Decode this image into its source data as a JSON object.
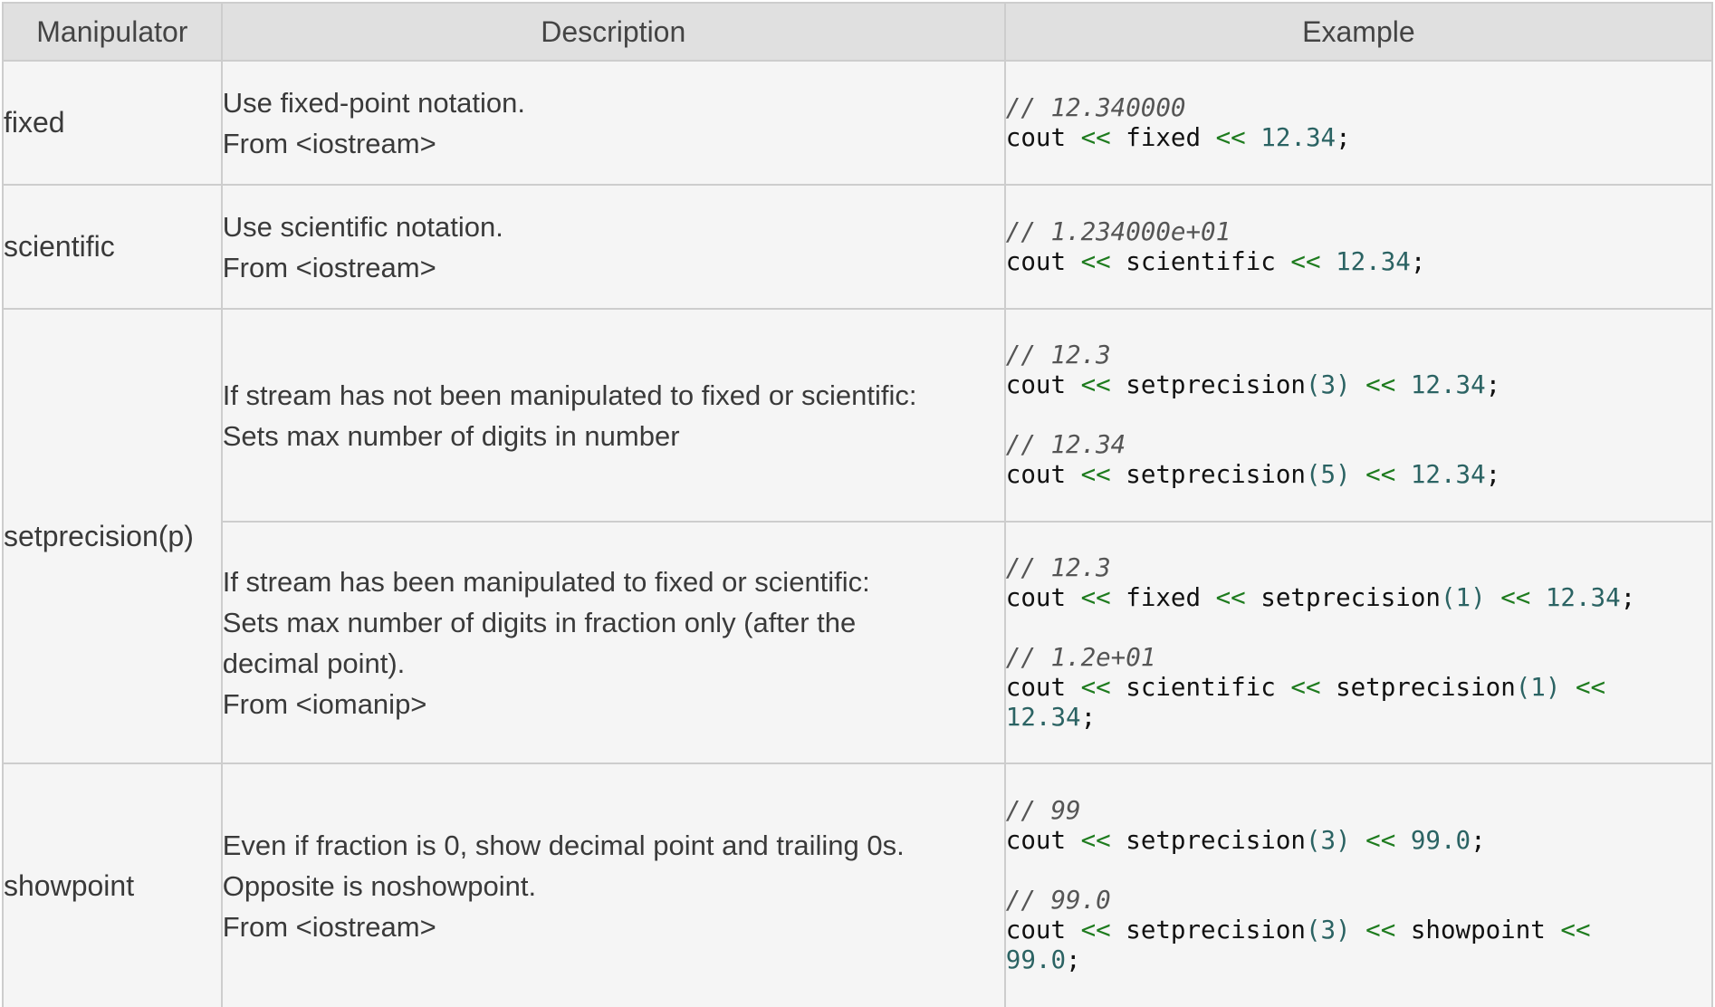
{
  "headers": {
    "manipulator": "Manipulator",
    "description": "Description",
    "example": "Example"
  },
  "rows": {
    "fixed": {
      "name": "fixed",
      "desc": [
        "Use fixed-point notation.",
        "From <iostream>"
      ],
      "examples": [
        {
          "comment": "// 12.340000",
          "code": [
            [
              [
                "t",
                "cout "
              ],
              [
                "o",
                "<<"
              ],
              [
                "t",
                " fixed "
              ],
              [
                "o",
                "<<"
              ],
              [
                "n",
                " 12.34"
              ],
              [
                "t",
                ";"
              ]
            ]
          ]
        }
      ]
    },
    "scientific": {
      "name": "scientific",
      "desc": [
        "Use scientific notation.",
        "From <iostream>"
      ],
      "examples": [
        {
          "comment": "// 1.234000e+01",
          "code": [
            [
              [
                "t",
                "cout "
              ],
              [
                "o",
                "<<"
              ],
              [
                "t",
                " scientific "
              ],
              [
                "o",
                "<<"
              ],
              [
                "n",
                " 12.34"
              ],
              [
                "t",
                ";"
              ]
            ]
          ]
        }
      ]
    },
    "setprecision": {
      "name": "setprecision(p)",
      "a": {
        "desc": [
          "If stream has not been manipulated to fixed or scientific:",
          "Sets max number of digits in number"
        ],
        "examples": [
          {
            "comment": "// 12.3",
            "code": [
              [
                [
                  "t",
                  "cout "
                ],
                [
                  "o",
                  "<<"
                ],
                [
                  "t",
                  " setprecision"
                ],
                [
                  "n",
                  "(3)"
                ],
                [
                  "o",
                  " <<"
                ],
                [
                  "n",
                  " 12.34"
                ],
                [
                  "t",
                  ";"
                ]
              ]
            ]
          },
          {
            "comment": "// 12.34",
            "code": [
              [
                [
                  "t",
                  "cout "
                ],
                [
                  "o",
                  "<<"
                ],
                [
                  "t",
                  " setprecision"
                ],
                [
                  "n",
                  "(5)"
                ],
                [
                  "o",
                  " <<"
                ],
                [
                  "n",
                  " 12.34"
                ],
                [
                  "t",
                  ";"
                ]
              ]
            ]
          }
        ]
      },
      "b": {
        "desc": [
          "If stream has been manipulated to fixed or scientific:",
          "Sets max number of digits in fraction only (after the",
          "decimal point).",
          "From <iomanip>"
        ],
        "examples": [
          {
            "comment": "// 12.3",
            "code": [
              [
                [
                  "t",
                  "cout "
                ],
                [
                  "o",
                  "<<"
                ],
                [
                  "t",
                  " fixed "
                ],
                [
                  "o",
                  "<<"
                ],
                [
                  "t",
                  " setprecision"
                ],
                [
                  "n",
                  "(1)"
                ],
                [
                  "o",
                  " <<"
                ],
                [
                  "n",
                  " 12.34"
                ],
                [
                  "t",
                  ";"
                ]
              ]
            ]
          },
          {
            "comment": "// 1.2e+01",
            "code": [
              [
                [
                  "t",
                  "cout "
                ],
                [
                  "o",
                  "<<"
                ],
                [
                  "t",
                  " scientific "
                ],
                [
                  "o",
                  "<<"
                ],
                [
                  "t",
                  " setprecision"
                ],
                [
                  "n",
                  "(1)"
                ],
                [
                  "o",
                  " <<"
                ]
              ],
              [
                [
                  "n",
                  "12.34"
                ],
                [
                  "t",
                  ";"
                ]
              ]
            ]
          }
        ]
      }
    },
    "showpoint": {
      "name": "showpoint",
      "desc": [
        "Even if fraction is 0, show decimal point and trailing 0s.",
        "Opposite is noshowpoint.",
        "From <iostream>"
      ],
      "examples": [
        {
          "comment": "// 99",
          "code": [
            [
              [
                "t",
                "cout "
              ],
              [
                "o",
                "<<"
              ],
              [
                "t",
                " setprecision"
              ],
              [
                "n",
                "(3)"
              ],
              [
                "o",
                " <<"
              ],
              [
                "n",
                " 99.0"
              ],
              [
                "t",
                ";"
              ]
            ]
          ]
        },
        {
          "comment": "// 99.0",
          "code": [
            [
              [
                "t",
                "cout "
              ],
              [
                "o",
                "<<"
              ],
              [
                "t",
                " setprecision"
              ],
              [
                "n",
                "(3)"
              ],
              [
                "o",
                " <<"
              ],
              [
                "t",
                " showpoint "
              ],
              [
                "o",
                "<<"
              ]
            ],
            [
              [
                "n",
                "99.0"
              ],
              [
                "t",
                ";"
              ]
            ]
          ]
        }
      ]
    }
  }
}
